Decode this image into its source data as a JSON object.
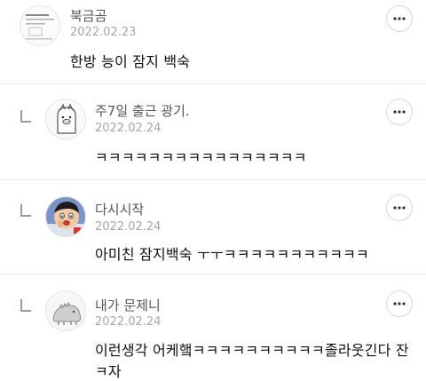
{
  "comments": [
    {
      "author": "북금곰",
      "date": "2022.02.23",
      "text": "한방 능이 잠지 백숙",
      "avatar_icon": "document-thumbnail-avatar",
      "is_reply": false
    },
    {
      "author": "주7일 출근 광기.",
      "date": "2022.02.24",
      "text": "ㅋㅋㅋㅋㅋㅋㅋㅋㅋㅋㅋㅋㅋㅋㅋㅋ",
      "avatar_icon": "pig-character-avatar",
      "is_reply": true
    },
    {
      "author": "다시시작",
      "date": "2022.02.24",
      "text": "아미친 잠지백숙 ㅜㅜㅋㅋㅋㅋㅋㅋㅋㅋㅋㅋㅋ",
      "avatar_icon": "cartoon-boy-avatar",
      "is_reply": true
    },
    {
      "author": "내가 문제니",
      "date": "2022.02.24",
      "text_line1": "이런생각 어케햌ㅋㅋㅋㅋㅋㅋㅋㅋㅋㅋ졸라웃긴다 잔",
      "text_line2": "ㅋ자",
      "avatar_icon": "dinosaur-character-avatar",
      "is_reply": true
    }
  ],
  "more_icon": "more-options-icon",
  "colors": {
    "author": "#555555",
    "date": "#a6a6a6",
    "text": "#111111",
    "divider": "#e6e6e6"
  }
}
